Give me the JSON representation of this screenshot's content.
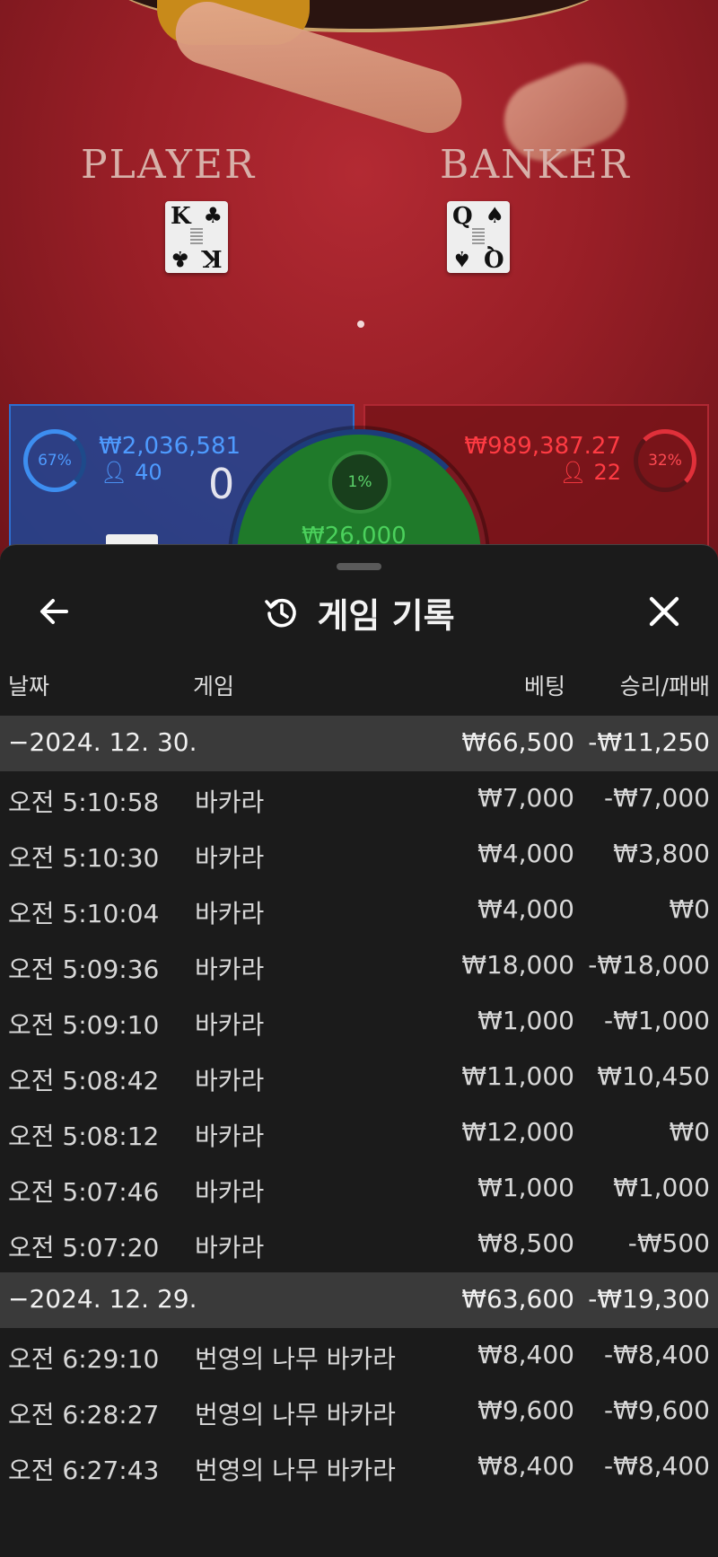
{
  "table": {
    "player_label": "PLAYER",
    "banker_label": "BANKER",
    "player_card": {
      "rank": "K",
      "suit": "♣"
    },
    "banker_card": {
      "rank": "Q",
      "suit": "♠"
    }
  },
  "bet_panel": {
    "player": {
      "percent": "67%",
      "amount": "₩2,036,581",
      "count": "40",
      "score": "0"
    },
    "banker": {
      "percent": "32%",
      "amount": "₩989,387.27",
      "count": "22"
    },
    "tie": {
      "percent": "1%",
      "amount": "₩26,000"
    }
  },
  "history": {
    "title": "게임 기록",
    "columns": {
      "date": "날짜",
      "game": "게임",
      "bet": "베팅",
      "result": "승리/패배"
    },
    "rows": [
      {
        "type": "group",
        "date": "−2024. 12. 30.",
        "game": "",
        "bet": "₩66,500",
        "result": "-₩11,250"
      },
      {
        "type": "item",
        "date": "오전 5:10:58",
        "game": "바카라",
        "bet": "₩7,000",
        "result": "-₩7,000"
      },
      {
        "type": "item",
        "date": "오전 5:10:30",
        "game": "바카라",
        "bet": "₩4,000",
        "result": "₩3,800"
      },
      {
        "type": "item",
        "date": "오전 5:10:04",
        "game": "바카라",
        "bet": "₩4,000",
        "result": "₩0"
      },
      {
        "type": "item",
        "date": "오전 5:09:36",
        "game": "바카라",
        "bet": "₩18,000",
        "result": "-₩18,000"
      },
      {
        "type": "item",
        "date": "오전 5:09:10",
        "game": "바카라",
        "bet": "₩1,000",
        "result": "-₩1,000"
      },
      {
        "type": "item",
        "date": "오전 5:08:42",
        "game": "바카라",
        "bet": "₩11,000",
        "result": "₩10,450"
      },
      {
        "type": "item",
        "date": "오전 5:08:12",
        "game": "바카라",
        "bet": "₩12,000",
        "result": "₩0"
      },
      {
        "type": "item",
        "date": "오전 5:07:46",
        "game": "바카라",
        "bet": "₩1,000",
        "result": "₩1,000"
      },
      {
        "type": "item",
        "date": "오전 5:07:20",
        "game": "바카라",
        "bet": "₩8,500",
        "result": "-₩500"
      },
      {
        "type": "group",
        "date": "−2024. 12. 29.",
        "game": "",
        "bet": "₩63,600",
        "result": "-₩19,300"
      },
      {
        "type": "item",
        "date": "오전 6:29:10",
        "game": "번영의 나무 바카라",
        "bet": "₩8,400",
        "result": "-₩8,400"
      },
      {
        "type": "item",
        "date": "오전 6:28:27",
        "game": "번영의 나무 바카라",
        "bet": "₩9,600",
        "result": "-₩9,600"
      },
      {
        "type": "item",
        "date": "오전 6:27:43",
        "game": "번영의 나무 바카라",
        "bet": "₩8,400",
        "result": "-₩8,400"
      }
    ]
  },
  "colors": {
    "player": "#4e9bff",
    "banker": "#ff3b43",
    "tie": "#4bd15c",
    "group_row_bg": "#3a3a3a"
  },
  "icons": {
    "back": "arrow-left-icon",
    "history": "history-icon",
    "close": "close-icon"
  }
}
